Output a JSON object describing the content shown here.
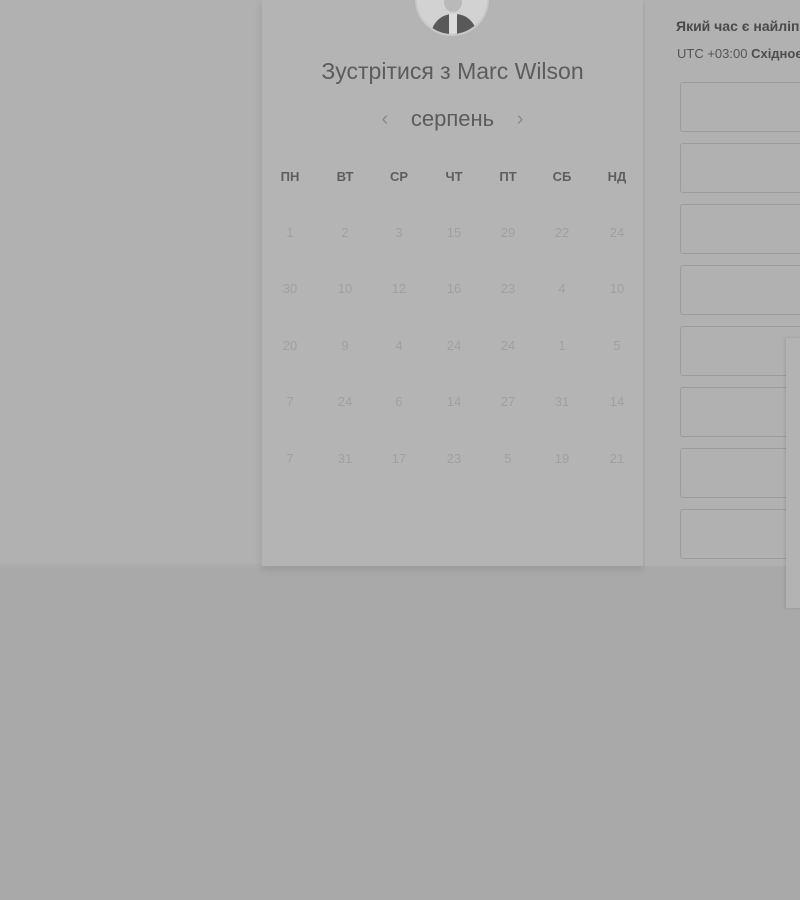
{
  "header": {
    "title": "Зустрітися з Marc Wilson"
  },
  "calendar": {
    "prev_label": "‹",
    "next_label": "›",
    "month": "серпень",
    "weekdays": [
      "ПН",
      "ВТ",
      "СР",
      "ЧТ",
      "ПТ",
      "СБ",
      "НД"
    ],
    "weeks": [
      [
        "1",
        "2",
        "3",
        "15",
        "29",
        "22",
        "24"
      ],
      [
        "30",
        "10",
        "12",
        "16",
        "23",
        "4",
        "10"
      ],
      [
        "20",
        "9",
        "4",
        "24",
        "24",
        "1",
        "5"
      ],
      [
        "7",
        "24",
        "6",
        "14",
        "27",
        "31",
        "14"
      ],
      [
        "7",
        "31",
        "17",
        "23",
        "5",
        "19",
        "21"
      ]
    ]
  },
  "times": {
    "question": "Який час є найліпшим?",
    "timezone_offset": "UTC +03:00",
    "timezone_name": "Східноєвропейський час",
    "slot_count": 8
  },
  "icons": {
    "prev": "chevron-left-icon",
    "next": "chevron-right-icon",
    "avatar": "user-avatar"
  }
}
